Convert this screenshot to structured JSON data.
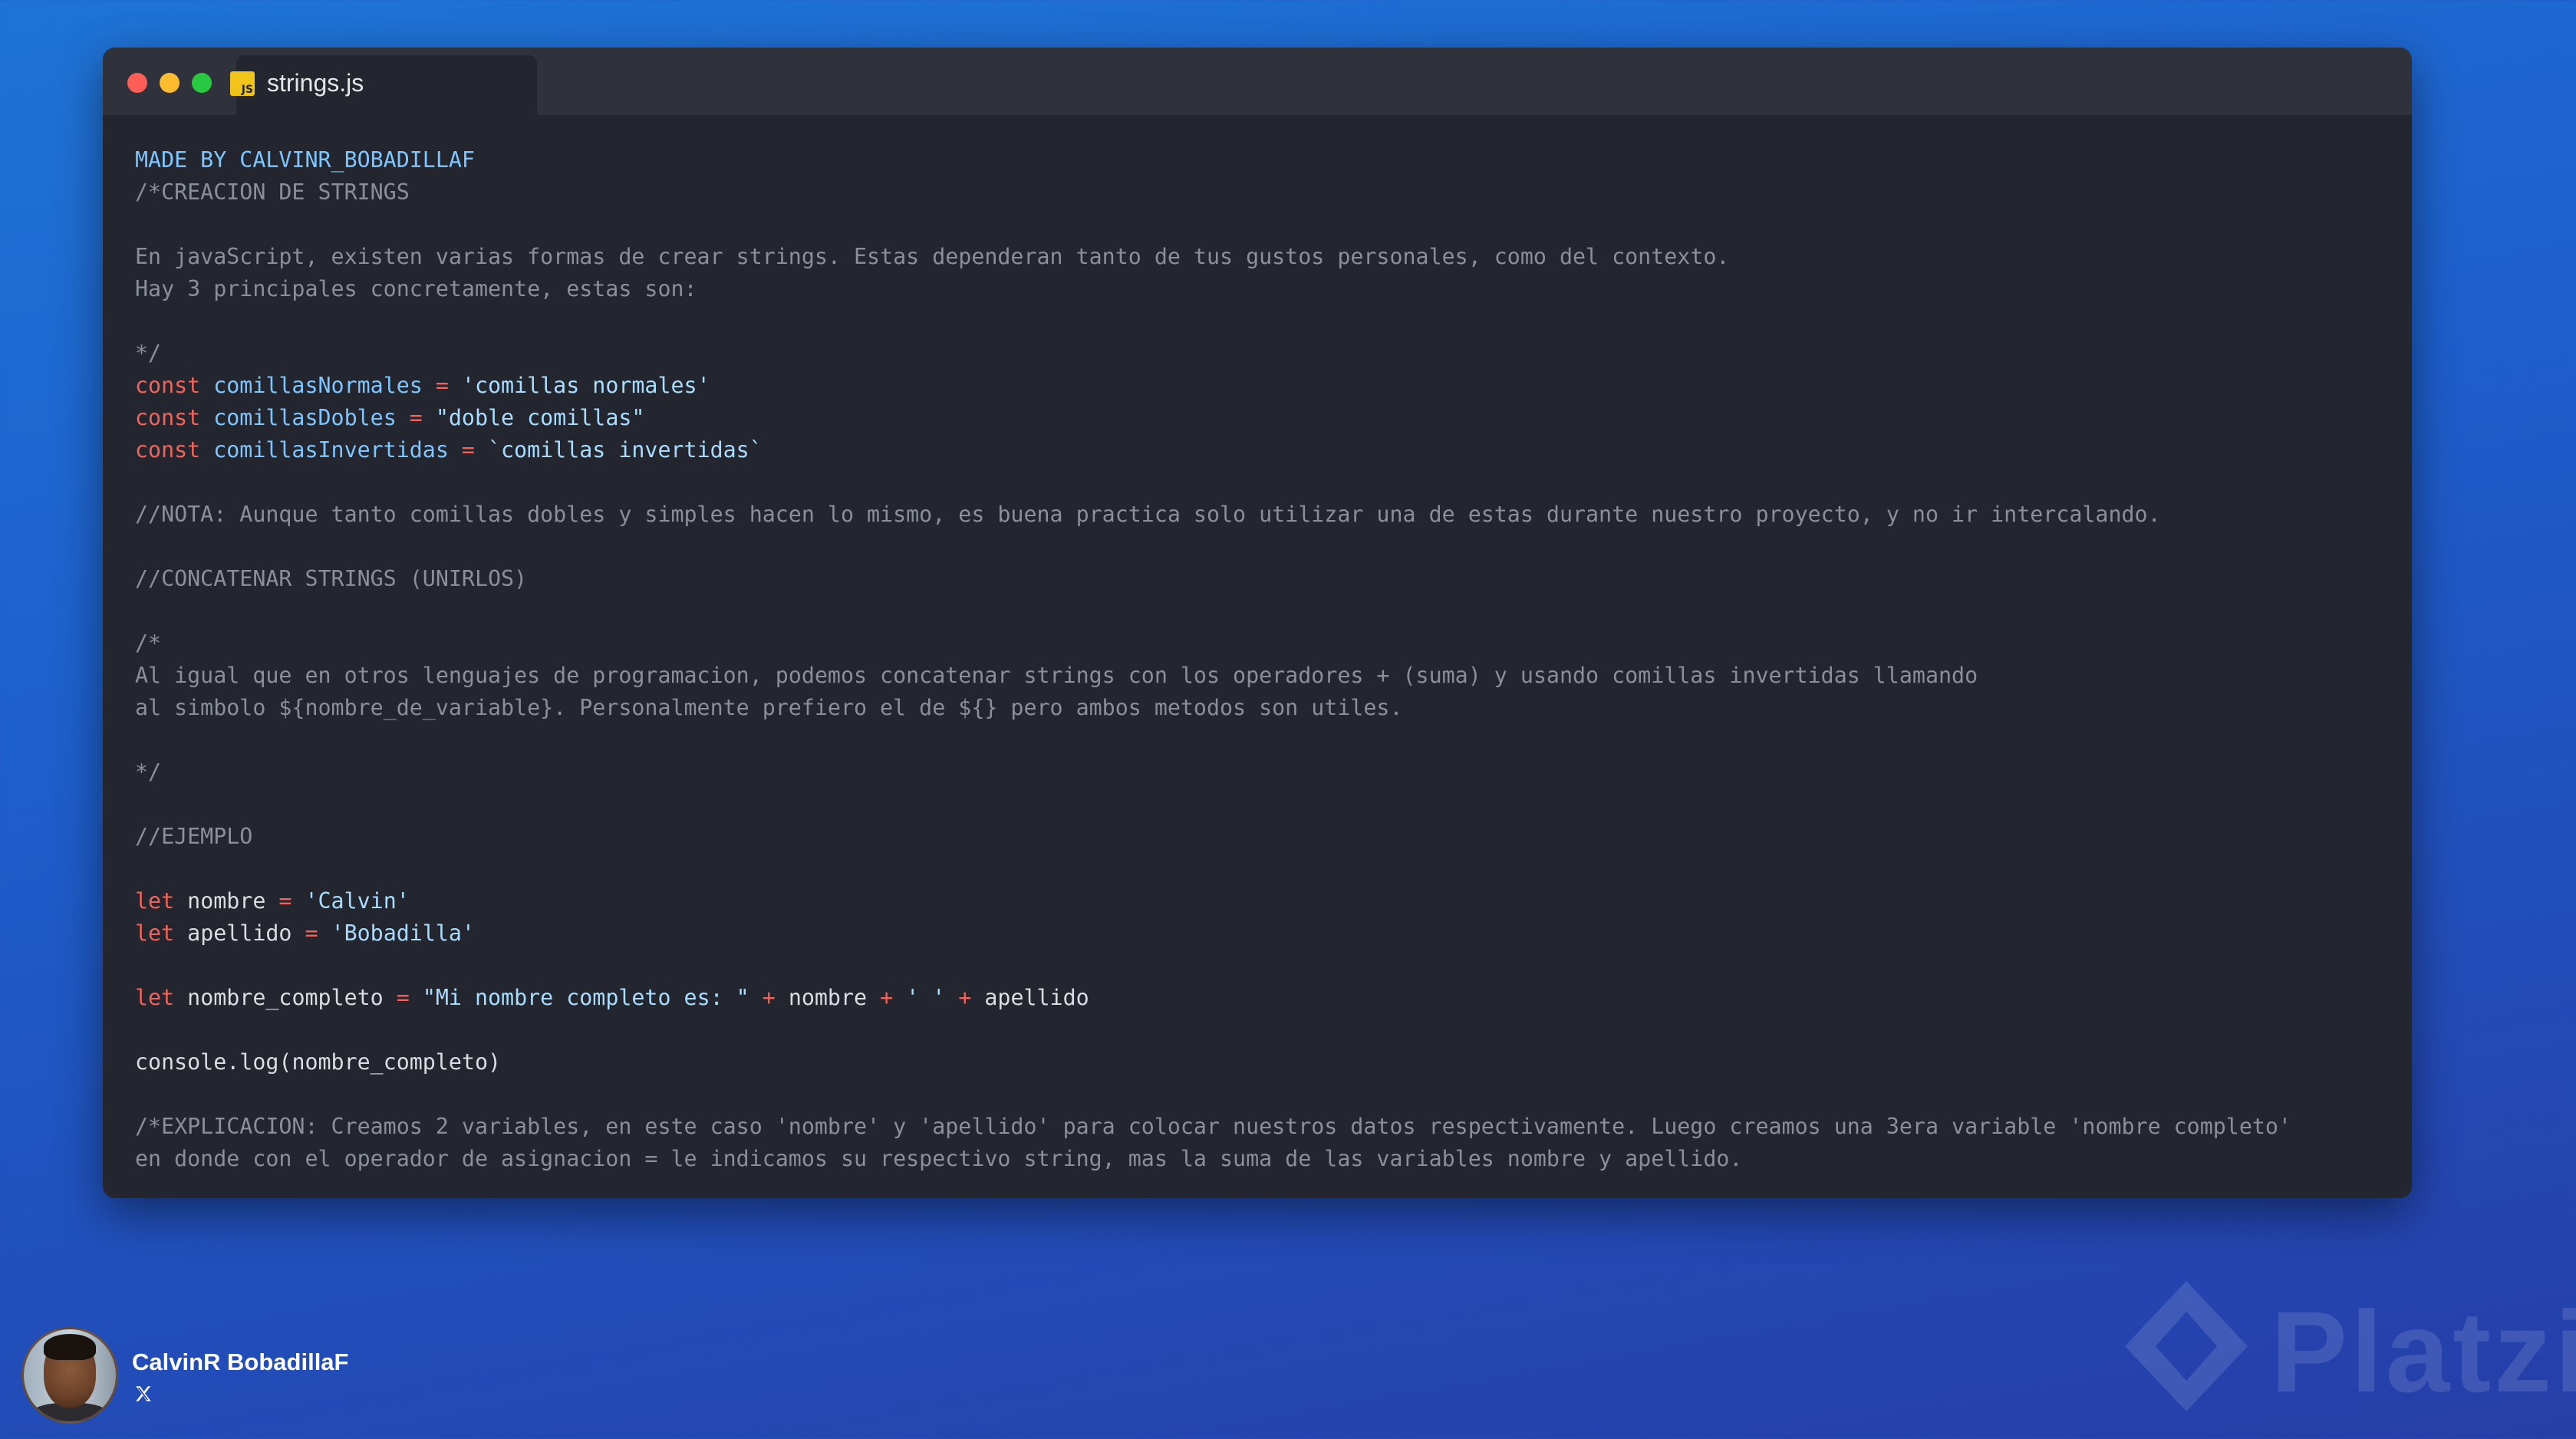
{
  "window": {
    "tab_label": "strings.js",
    "tab_icon_text": "JS",
    "tab_icon": "javascript-file-icon"
  },
  "code_lines": [
    [
      {
        "t": "MADE BY CALVINR_BOBADILLAF",
        "c": "blue"
      }
    ],
    [
      {
        "t": "/*CREACION DE STRINGS",
        "c": "comment"
      }
    ],
    [],
    [
      {
        "t": "En javaScript, existen varias formas de crear strings. Estas dependeran tanto de tus gustos personales, como del contexto.",
        "c": "comment"
      }
    ],
    [
      {
        "t": "Hay 3 principales concretamente, estas son:",
        "c": "comment"
      }
    ],
    [],
    [
      {
        "t": "*/",
        "c": "comment"
      }
    ],
    [
      {
        "t": "const ",
        "c": "kw"
      },
      {
        "t": "comillasNormales",
        "c": "var"
      },
      {
        "t": " = ",
        "c": "op"
      },
      {
        "t": "'comillas normales'",
        "c": "str"
      }
    ],
    [
      {
        "t": "const ",
        "c": "kw"
      },
      {
        "t": "comillasDobles",
        "c": "var"
      },
      {
        "t": " = ",
        "c": "op"
      },
      {
        "t": "\"doble comillas\"",
        "c": "str"
      }
    ],
    [
      {
        "t": "const ",
        "c": "kw"
      },
      {
        "t": "comillasInvertidas",
        "c": "var"
      },
      {
        "t": " = ",
        "c": "op"
      },
      {
        "t": "`comillas invertidas`",
        "c": "str"
      }
    ],
    [],
    [
      {
        "t": "//NOTA: Aunque tanto comillas dobles y simples hacen lo mismo, es buena practica solo utilizar una de estas durante nuestro proyecto, y no ir intercalando.",
        "c": "comment"
      }
    ],
    [],
    [
      {
        "t": "//CONCATENAR STRINGS (UNIRLOS)",
        "c": "comment"
      }
    ],
    [],
    [
      {
        "t": "/*",
        "c": "comment"
      }
    ],
    [
      {
        "t": "Al igual que en otros lenguajes de programacion, podemos concatenar strings con los operadores + (suma) y usando comillas invertidas llamando",
        "c": "comment"
      }
    ],
    [
      {
        "t": "al simbolo ${nombre_de_variable}. Personalmente prefiero el de ${} pero ambos metodos son utiles.",
        "c": "comment"
      }
    ],
    [],
    [
      {
        "t": "*/",
        "c": "comment"
      }
    ],
    [],
    [
      {
        "t": "//EJEMPLO",
        "c": "comment"
      }
    ],
    [],
    [
      {
        "t": "let ",
        "c": "kw"
      },
      {
        "t": "nombre",
        "c": "plain"
      },
      {
        "t": " = ",
        "c": "op"
      },
      {
        "t": "'Calvin'",
        "c": "str"
      }
    ],
    [
      {
        "t": "let ",
        "c": "kw"
      },
      {
        "t": "apellido",
        "c": "plain"
      },
      {
        "t": " = ",
        "c": "op"
      },
      {
        "t": "'Bobadilla'",
        "c": "str"
      }
    ],
    [],
    [
      {
        "t": "let ",
        "c": "kw"
      },
      {
        "t": "nombre_completo",
        "c": "plain"
      },
      {
        "t": " = ",
        "c": "op"
      },
      {
        "t": "\"Mi nombre completo es: \"",
        "c": "str"
      },
      {
        "t": " + ",
        "c": "op"
      },
      {
        "t": "nombre",
        "c": "plain"
      },
      {
        "t": " + ",
        "c": "op"
      },
      {
        "t": "' '",
        "c": "str"
      },
      {
        "t": " + ",
        "c": "op"
      },
      {
        "t": "apellido",
        "c": "plain"
      }
    ],
    [],
    [
      {
        "t": "console.",
        "c": "plain"
      },
      {
        "t": "log",
        "c": "plain"
      },
      {
        "t": "(nombre_completo)",
        "c": "plain"
      }
    ],
    [],
    [
      {
        "t": "/*EXPLICACION: Creamos 2 variables, en este caso 'nombre' y 'apellido' para colocar nuestros datos respectivamente. Luego creamos una 3era variable 'nombre completo'",
        "c": "comment"
      }
    ],
    [
      {
        "t": "en donde con el operador de asignacion = le indicamos su respectivo string, mas la suma de las variables nombre y apellido.",
        "c": "comment"
      }
    ]
  ],
  "profile": {
    "name": "CalvinR BobadillaF",
    "avatar": "profile-photo",
    "social_icon": "x-twitter-icon"
  },
  "watermark": {
    "text": "Platzi",
    "logo": "platzi-logo"
  },
  "colors": {
    "background_top": "#1f73d6",
    "background_bottom": "#263ea8",
    "editor_bg": "#23262e",
    "titlebar_bg": "#2f323b",
    "keyword": "#f2645b",
    "variable": "#7ec6ff",
    "string": "#a9ddff",
    "comment": "#8b8f98"
  }
}
